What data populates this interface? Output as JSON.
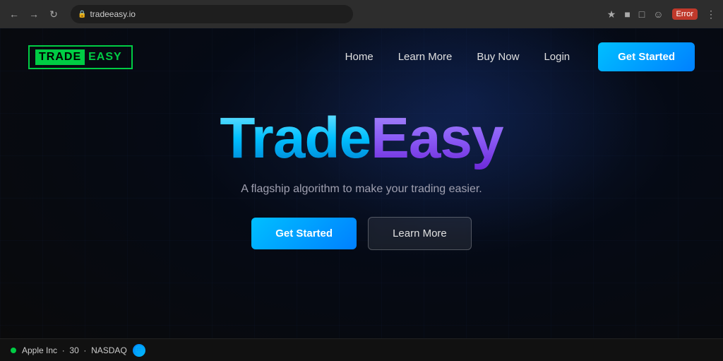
{
  "browser": {
    "url": "tradeeasy.io",
    "error_label": "Error",
    "nav_back": "‹",
    "nav_forward": "›",
    "nav_refresh": "↻"
  },
  "navbar": {
    "logo_trade": "TRADE",
    "logo_easy": "EASY",
    "links": [
      {
        "label": "Home",
        "id": "home"
      },
      {
        "label": "Learn More",
        "id": "learn-more"
      },
      {
        "label": "Buy Now",
        "id": "buy-now"
      },
      {
        "label": "Login",
        "id": "login"
      }
    ],
    "cta_label": "Get Started"
  },
  "hero": {
    "title_trade": "Trade",
    "title_easy": "Easy",
    "subtitle": "A flagship algorithm to make your trading easier.",
    "btn_get_started": "Get Started",
    "btn_learn_more": "Learn More"
  },
  "ticker": {
    "company": "Apple Inc",
    "value": "30",
    "exchange": "NASDAQ"
  }
}
